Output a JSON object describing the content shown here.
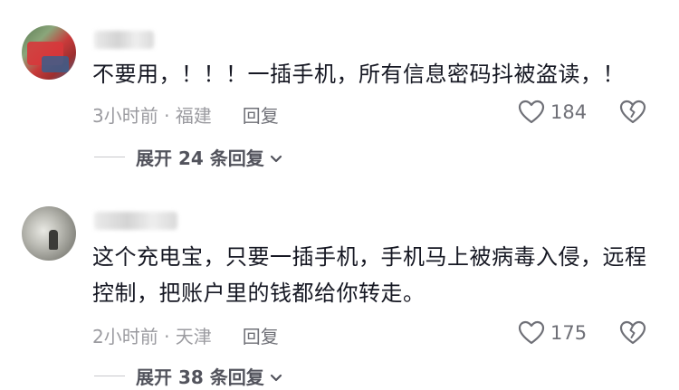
{
  "comments": [
    {
      "text": "不要用，！！！一插手机，所有信息密码抖被盗读，！",
      "time_location": "3小时前 · 福建",
      "reply_label": "回复",
      "likes": "184",
      "expand_label": "展开 24 条回复"
    },
    {
      "text": "这个充电宝，只要一插手机，手机马上被病毒入侵，远程控制，把账户里的钱都给你转走。",
      "time_location": "2小时前 · 天津",
      "reply_label": "回复",
      "likes": "175",
      "expand_label": "展开 38 条回复"
    }
  ],
  "icons": {
    "like": "heart-outline-icon",
    "dislike": "broken-heart-outline-icon",
    "expand": "chevron-down-icon"
  }
}
